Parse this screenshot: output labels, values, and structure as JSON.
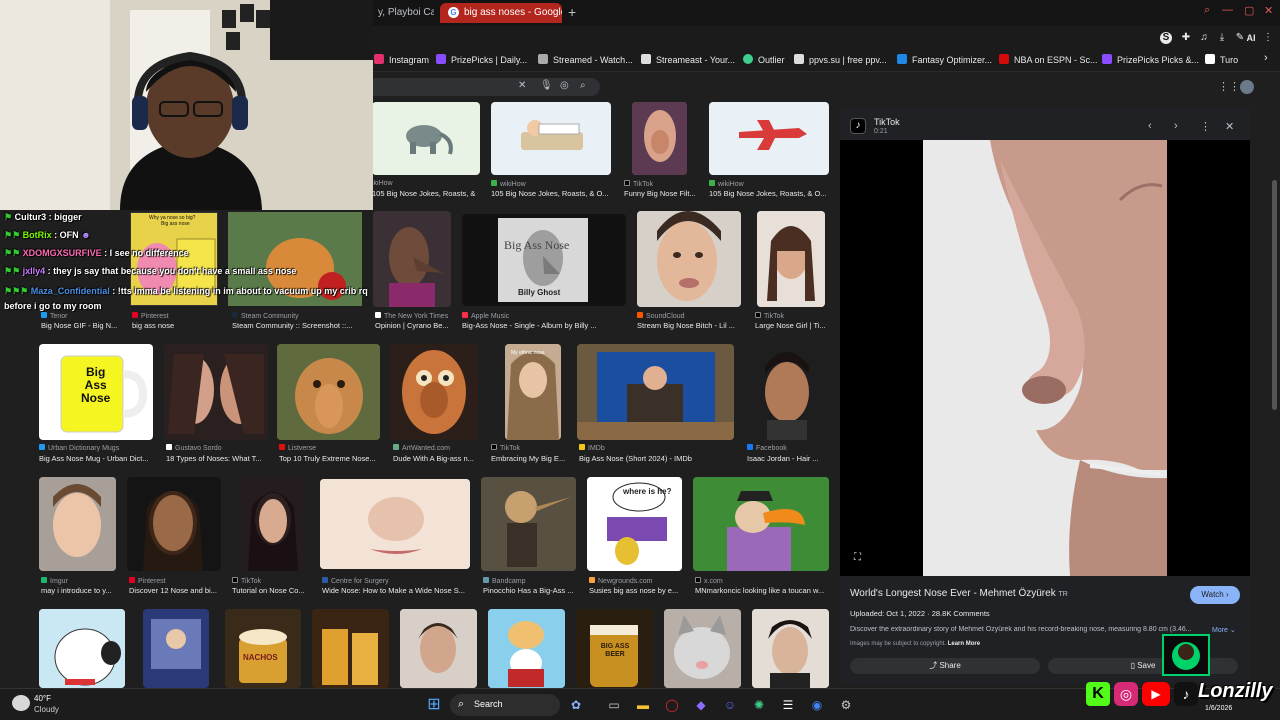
{
  "browser": {
    "tabs": [
      {
        "label": "y, Playboi Carti"
      },
      {
        "label": "big ass noses - Google Se",
        "active": true
      }
    ],
    "new_tab_symbol": "+",
    "bookmarks": [
      {
        "label": "Instagram",
        "color": "#e1306c"
      },
      {
        "label": "PrizePicks | Daily...",
        "color": "#8a4cff"
      },
      {
        "label": "Streamed - Watch...",
        "color": "#aaaaaa"
      },
      {
        "label": "Streameast - Your...",
        "color": "#dddddd"
      },
      {
        "label": "Outlier",
        "color": "#3ecf8e"
      },
      {
        "label": "ppvs.su | free ppv...",
        "color": "#dddddd"
      },
      {
        "label": "Fantasy Optimizer...",
        "color": "#1e88e5"
      },
      {
        "label": "NBA on ESPN - Sc...",
        "color": "#d50a0a"
      },
      {
        "label": "PrizePicks Picks &...",
        "color": "#8a4cff"
      },
      {
        "label": "Turo",
        "color": "#ffffff"
      }
    ],
    "toolbar_ai": "AI"
  },
  "results": {
    "row1": [
      {
        "source": "wikiHow",
        "caption": ""
      },
      {
        "source": "wikiHow",
        "caption": "105 Big Nose Jokes, Roasts, & O..."
      },
      {
        "source": "TikTok",
        "caption": "Funny Big Nose Filt..."
      },
      {
        "source": "wikiHow",
        "caption": "105 Big Nose Jokes, Roasts, & O..."
      }
    ],
    "row1_first_caption": "ikiHow",
    "row1_first_title": "105 Big Nose Jokes, Roasts, & O...",
    "row2": [
      {
        "source": "Tenor",
        "caption": "Big Nose GIF - Big N..."
      },
      {
        "source": "Pinterest",
        "caption": "big ass nose"
      },
      {
        "source": "Steam Community",
        "caption": "Steam Community :: Screenshot ::..."
      },
      {
        "source": "The New York Times",
        "caption": "Opinion | Cyrano Be..."
      },
      {
        "source": "Apple Music",
        "caption": "Big-Ass Nose - Single - Album by Billy ..."
      },
      {
        "source": "SoundCloud",
        "caption": "Stream Big Nose Bitch - Lil ..."
      },
      {
        "source": "TikTok",
        "caption": "Large Nose Girl | Ti..."
      }
    ],
    "row3": [
      {
        "source": "Urban Dictionary Mugs",
        "caption": "Big Ass Nose Mug - Urban Dict..."
      },
      {
        "source": "Gustavo Sordo",
        "caption": "18 Types of Noses: What T..."
      },
      {
        "source": "Listverse",
        "caption": "Top 10 Truly Extreme Nose..."
      },
      {
        "source": "ArtWanted.com",
        "caption": "Dude With A Big-ass n..."
      },
      {
        "source": "TikTok",
        "caption": "Embracing My Big E..."
      },
      {
        "source": "IMDb",
        "caption": "Big Ass Nose (Short 2024) - IMDb"
      },
      {
        "source": "Facebook",
        "caption": "Isaac Jordan - Hair ..."
      }
    ],
    "row4": [
      {
        "source": "Imgur",
        "caption": "may i introduce to y..."
      },
      {
        "source": "Pinterest",
        "caption": "Discover 12 Nose and bi..."
      },
      {
        "source": "TikTok",
        "caption": "Tutorial on Nose Co..."
      },
      {
        "source": "Centre for Surgery",
        "caption": "Wide Nose: How to Make a Wide Nose S..."
      },
      {
        "source": "Bandcamp",
        "caption": "Pinocchio Has a Big-Ass ..."
      },
      {
        "source": "Newgrounds.com",
        "caption": "Susies big ass nose by e..."
      },
      {
        "source": "x.com",
        "caption": "MNmarkoncic looking like a toucan w..."
      }
    ],
    "mug_text": [
      "Big",
      "Ass",
      "Nose"
    ],
    "album_text": "Big Ass Nose",
    "album_sub": "Billy Ghost",
    "tiktok_overlay": "My ethnic nose",
    "susie_text": "where is he?",
    "beer_text": "BIG ASS BEER",
    "nacho_text": "NACHOS",
    "meme_text1": "Why ya nose so big?",
    "meme_text2": "Big ass nose"
  },
  "panel": {
    "source": "TikTok",
    "duration": "0:21",
    "title": "World's Longest Nose Ever - Mehmet Özyürek",
    "title_suffix": "TR",
    "watch_label": "Watch",
    "meta": "Uploaded: Oct 1, 2022 · 28.8K Comments",
    "description": "Discover the extraordinary story of Mehmet Özyürek and his record-breaking nose, measuring 8.80 cm (3.46...",
    "more_label": "More",
    "copyright": "Images may be subject to copyright.",
    "learn_more": "Learn More",
    "share_label": "Share",
    "save_label": "Save"
  },
  "chat": [
    {
      "user": "Cultur3",
      "text": "bigger",
      "color": "#ffffff"
    },
    {
      "user": "BotRix",
      "text": "OFN",
      "color": "#7cfc00"
    },
    {
      "user": "XDOMGXSURFIVE",
      "text": "I see no difference",
      "color": "#ff69b4"
    },
    {
      "user": "jxlly4",
      "text": "they js say that because you don't have a small ass nose",
      "color": "#c77dff"
    },
    {
      "user": "Maza_Confidential",
      "text": "!tts imma be listening in im about to vacuum up my crib rq before i go to my room",
      "color": "#4a90e2"
    }
  ],
  "taskbar": {
    "weather_temp": "40°F",
    "weather_desc": "Cloudy",
    "search_label": "Search",
    "date": "1/6/2026"
  },
  "overlay": {
    "brand": "Lonzilly"
  }
}
